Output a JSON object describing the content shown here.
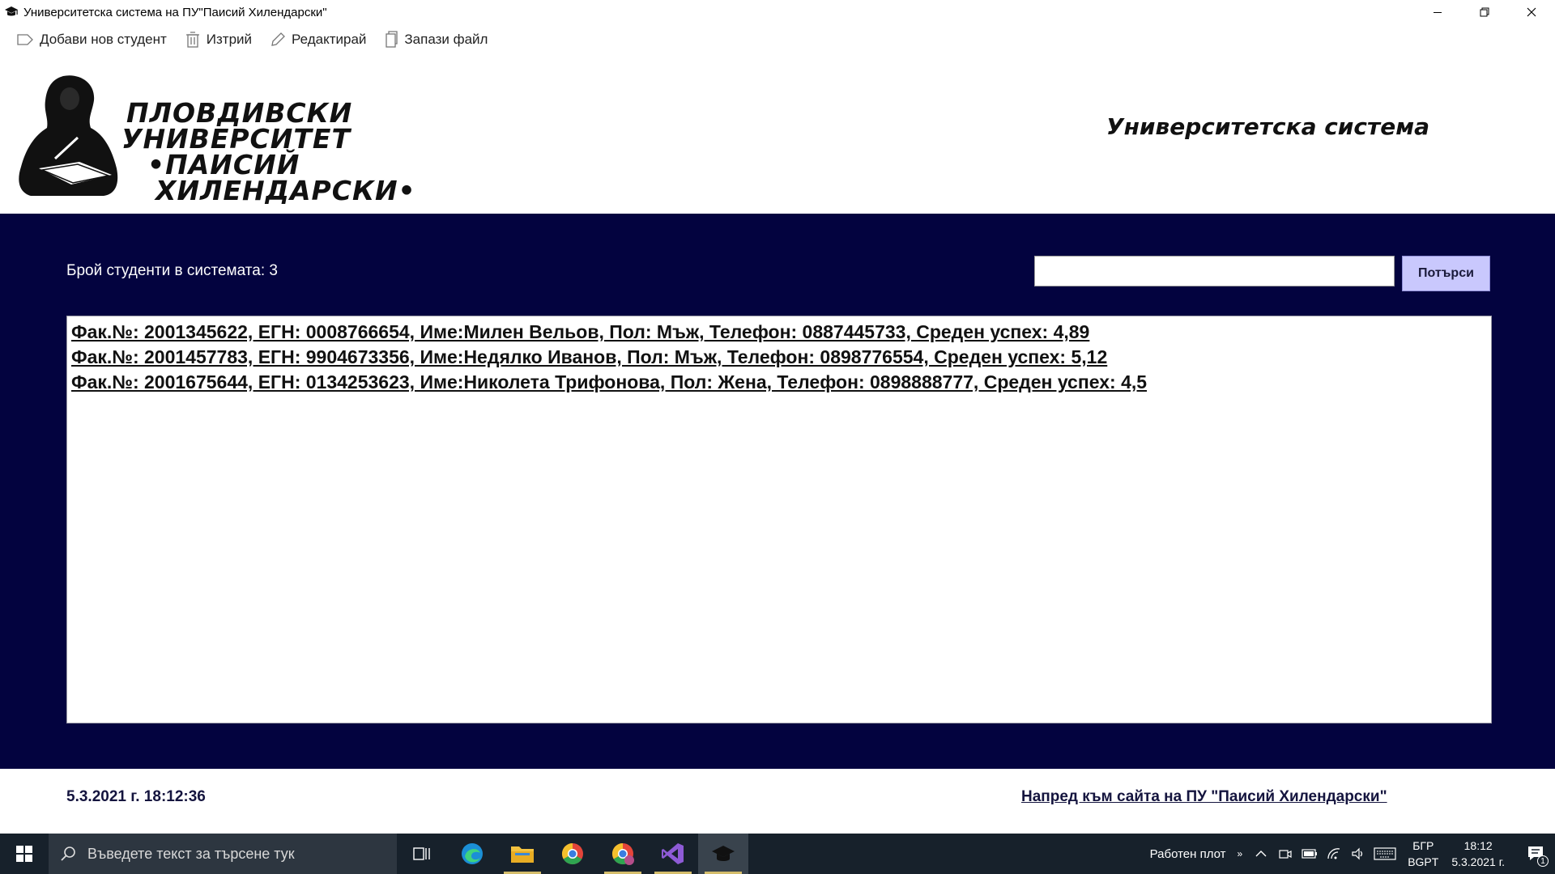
{
  "window": {
    "title": "Университетска система на ПУ\"Паисий Хилендарски\""
  },
  "toolbar": {
    "add_label": "Добави нов студент",
    "delete_label": "Изтрий",
    "edit_label": "Редактирай",
    "save_label": "Запази файл"
  },
  "header": {
    "logo_lines": [
      "ПЛОВДИВСКИ",
      "УНИВЕРСИТЕТ",
      "•ПАИСИЙ",
      "ХИЛЕНДАРСКИ•"
    ],
    "system_title": "Университетска система"
  },
  "main": {
    "student_count_text": "Брой студенти в системата: 3",
    "search": {
      "value": "",
      "button_label": "Потърси"
    },
    "students": [
      "Фак.№: 2001345622, ЕГН: 0008766654, Име:Милен Вельов, Пол: Мъж,  Телефон: 0887445733, Среден успех: 4,89",
      "Фак.№: 2001457783, ЕГН: 9904673356, Име:Недялко Иванов, Пол: Мъж,  Телефон: 0898776554, Среден успех: 5,12",
      "Фак.№: 2001675644, ЕГН: 0134253623, Име:Николета Трифонова, Пол: Жена,  Телефон: 0898888777, Среден успех: 4,5"
    ]
  },
  "footer": {
    "datetime": "5.3.2021 г. 18:12:36",
    "site_link": "Напред към сайта на ПУ \"Паисий Хилендарски\""
  },
  "taskbar": {
    "search_placeholder": "Въведете текст за търсене тук",
    "desktop_label": "Работен плот",
    "lang_top": "БГР",
    "lang_bottom": "BGPT",
    "time": "18:12",
    "date": "5.3.2021 г.",
    "notification_count": "1"
  },
  "colors": {
    "main_bg": "#03033f",
    "search_button_bg": "#c9c8fd",
    "taskbar_bg": "#17212b"
  }
}
